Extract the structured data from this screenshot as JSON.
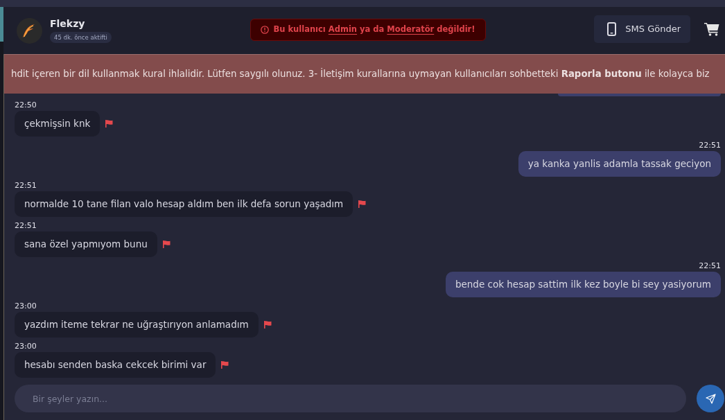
{
  "header": {
    "contact": {
      "name": "Flekzy",
      "last_seen": "45 dk. önce aktifti"
    },
    "warning": {
      "parts": [
        {
          "kind": "text",
          "text": "Bu kullanıcı"
        },
        {
          "kind": "link",
          "text": "Admin"
        },
        {
          "kind": "text",
          "text": "ya da"
        },
        {
          "kind": "link",
          "text": "Moderatör"
        },
        {
          "kind": "text",
          "text": "değildir!"
        }
      ]
    },
    "sms_button": "SMS Gönder"
  },
  "rules_banner": {
    "text": "hdit içeren bir dil kullanmak kural ihlalidir. Lütfen saygılı olunuz. 3- İletişim kurallarına uymayan kullanıcıları sohbetteki **Raporla butonu** ile kolayca biz"
  },
  "messages": [
    {
      "kind": "clipped"
    },
    {
      "kind": "received",
      "time": "22:50",
      "text": "çekmişsin knk"
    },
    {
      "kind": "sent",
      "time": "22:51",
      "text": "ya kanka yanlis adamla tassak geciyon"
    },
    {
      "kind": "received",
      "time": "22:51",
      "text": "normalde 10 tane filan valo hesap aldım ben ilk defa sorun yaşadım"
    },
    {
      "kind": "received",
      "time": "22:51",
      "text": "sana özel yapmıyom bunu"
    },
    {
      "kind": "sent",
      "time": "22:51",
      "text": "bende cok hesap sattim ilk kez boyle bi sey yasiyorum"
    },
    {
      "kind": "received",
      "time": "23:00",
      "text": "yazdım iteme tekrar ne uğraştırıyon anlamadım"
    },
    {
      "kind": "received",
      "time": "23:00",
      "text": "hesabı senden baska cekcek birimi var"
    }
  ],
  "composer": {
    "placeholder": "Bir şeyler yazın..."
  }
}
